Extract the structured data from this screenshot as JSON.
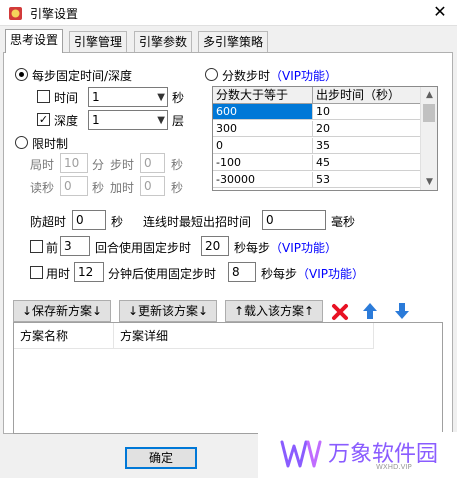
{
  "window": {
    "title": "引擎设置",
    "close_glyph": "✕"
  },
  "tabs": [
    "思考设置",
    "引擎管理",
    "引擎参数",
    "多引擎策略"
  ],
  "fixed_step": {
    "radio_label": "每步固定时间/深度",
    "time_label": "时间",
    "time_value": "1",
    "time_unit": "秒",
    "time_checked": false,
    "depth_label": "深度",
    "depth_value": "1",
    "depth_unit": "层",
    "depth_checked": true
  },
  "score_step": {
    "radio_label": "分数步时",
    "vip": "（VIP功能）",
    "columns": [
      "分数大于等于",
      "出步时间（秒）"
    ],
    "rows": [
      [
        "600",
        "10"
      ],
      [
        "300",
        "20"
      ],
      [
        "0",
        "35"
      ],
      [
        "-100",
        "45"
      ],
      [
        "-30000",
        "53"
      ]
    ]
  },
  "limit": {
    "radio_label": "限时制",
    "game_label": "局时",
    "game_value": "10",
    "game_unit": "分",
    "step_label": "步时",
    "step_value": "0",
    "step_unit": "秒",
    "byoyomi_label": "读秒",
    "byoyomi_value": "0",
    "byoyomi_unit": "秒",
    "increment_label": "加时",
    "increment_value": "0",
    "increment_unit": "秒"
  },
  "timeouts": {
    "timeout_label": "防超时",
    "timeout_value": "0",
    "timeout_unit": "秒",
    "connect_label": "连线时最短出招时间",
    "connect_value": "0",
    "connect_unit": "毫秒"
  },
  "rule1": {
    "prefix": "前",
    "value": "3",
    "middle": "回合使用固定步时",
    "step_value": "20",
    "suffix": "秒每步",
    "vip": "（VIP功能）"
  },
  "rule2": {
    "prefix": "用时",
    "value": "12",
    "middle": "分钟后使用固定步时",
    "step_value": "8",
    "suffix": "秒每步",
    "vip": "（VIP功能）"
  },
  "plan_buttons": {
    "save_new": "↓保存新方案↓",
    "update": "↓更新该方案↓",
    "load": "↑载入该方案↑"
  },
  "plan_list": {
    "columns": [
      "方案名称",
      "方案详细"
    ]
  },
  "footer": {
    "ok": "确定"
  },
  "watermark": {
    "brand": "万象软件园",
    "sub": "WXHD.VIP"
  },
  "colors": {
    "vip": "#0000ff",
    "selection": "#0078d7",
    "delete": "#e81123",
    "arrow": "#2b7bd9",
    "watermark": "#8a5cff"
  }
}
